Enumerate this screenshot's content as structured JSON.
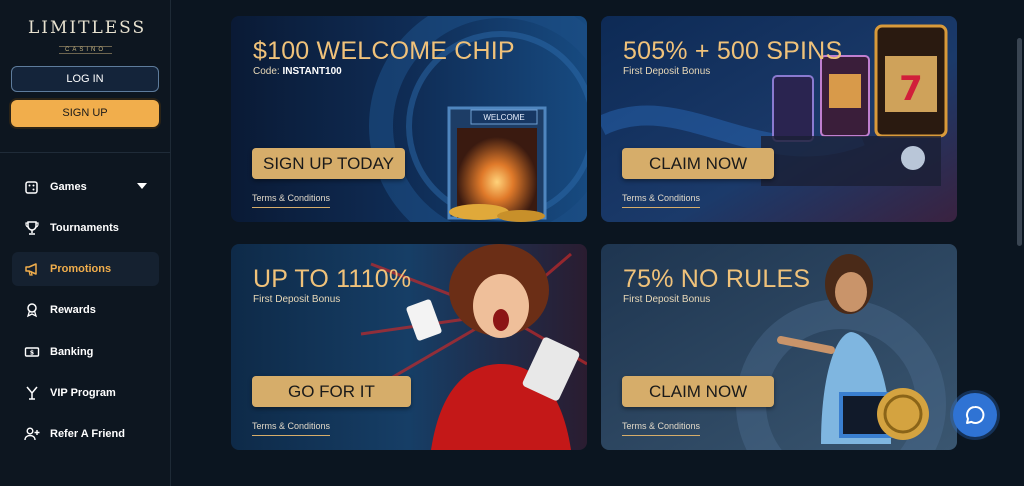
{
  "brand": {
    "logo_text": "LIMITLESS",
    "logo_sub": "CASINO"
  },
  "auth": {
    "login_label": "LOG IN",
    "signup_label": "SIGN UP"
  },
  "nav": {
    "items": [
      {
        "label": "Games",
        "icon": "dice-icon"
      },
      {
        "label": "Tournaments",
        "icon": "trophy-icon"
      },
      {
        "label": "Promotions",
        "icon": "megaphone-icon",
        "active": true
      },
      {
        "label": "Rewards",
        "icon": "award-icon"
      },
      {
        "label": "Banking",
        "icon": "banknote-icon"
      },
      {
        "label": "VIP Program",
        "icon": "vip-icon"
      },
      {
        "label": "Refer A Friend",
        "icon": "user-plus-icon"
      }
    ]
  },
  "promos": [
    {
      "title": "$100 WELCOME CHIP",
      "code_label": "Code:",
      "code": "INSTANT100",
      "button": "SIGN UP TODAY",
      "terms": "Terms & Conditions",
      "sign_text": "WELCOME"
    },
    {
      "title": "505% + 500 SPINS",
      "subtitle": "First Deposit Bonus",
      "button": "CLAIM NOW",
      "terms": "Terms & Conditions"
    },
    {
      "title": "UP TO 1110%",
      "subtitle": "First Deposit Bonus",
      "button": "GO FOR IT",
      "terms": "Terms & Conditions"
    },
    {
      "title": "75% NO RULES",
      "subtitle": "First Deposit Bonus",
      "button": "CLAIM NOW",
      "terms": "Terms & Conditions"
    }
  ],
  "colors": {
    "accent": "#f1ae4c",
    "gold_text": "#f0c27a",
    "button_gold": "#d6ad6a",
    "chat_blue": "#2f73d4"
  }
}
